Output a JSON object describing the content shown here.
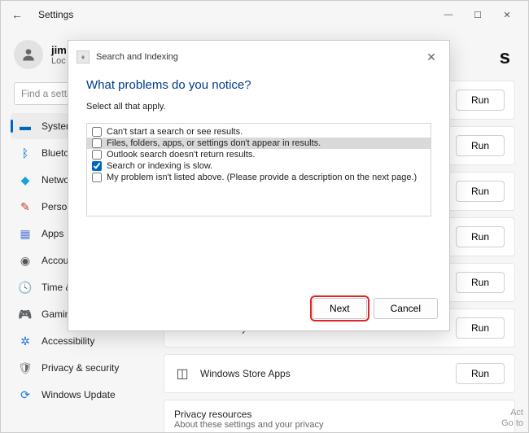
{
  "window": {
    "title": "Settings"
  },
  "user": {
    "name": "jim",
    "sub": "Loc"
  },
  "search": {
    "placeholder": "Find a setting"
  },
  "nav": {
    "items": [
      {
        "label": "System"
      },
      {
        "label": "Bluetooth"
      },
      {
        "label": "Network"
      },
      {
        "label": "Personal"
      },
      {
        "label": "Apps"
      },
      {
        "label": "Accounts"
      },
      {
        "label": "Time &"
      },
      {
        "label": "Gaming"
      },
      {
        "label": "Accessibility"
      },
      {
        "label": "Privacy & security"
      },
      {
        "label": "Windows Update"
      }
    ]
  },
  "main": {
    "cards": [
      {
        "label": "",
        "btn": "Run"
      },
      {
        "label": "",
        "btn": "Run"
      },
      {
        "label": "",
        "btn": "Run"
      },
      {
        "label": "",
        "btn": "Run"
      },
      {
        "label": "",
        "btn": "Run"
      },
      {
        "label": "Video Playback",
        "btn": "Run"
      },
      {
        "label": "Windows Store Apps",
        "btn": "Run"
      },
      {
        "label": "Privacy resources",
        "sub": "About these settings and your privacy"
      }
    ]
  },
  "dialog": {
    "title": "Search and Indexing",
    "heading": "What problems do you notice?",
    "sub": "Select all that apply.",
    "options": [
      {
        "label": "Can't start a search or see results.",
        "checked": false
      },
      {
        "label": "Files, folders, apps, or settings don't appear in results.",
        "checked": false,
        "hl": true
      },
      {
        "label": "Outlook search doesn't return results.",
        "checked": false
      },
      {
        "label": "Search or indexing is slow.",
        "checked": true
      },
      {
        "label": "My problem isn't listed above. (Please provide a description on the next page.)",
        "checked": false
      }
    ],
    "next": "Next",
    "cancel": "Cancel"
  },
  "watermark": {
    "line1": "Act",
    "line2": "Go to"
  }
}
